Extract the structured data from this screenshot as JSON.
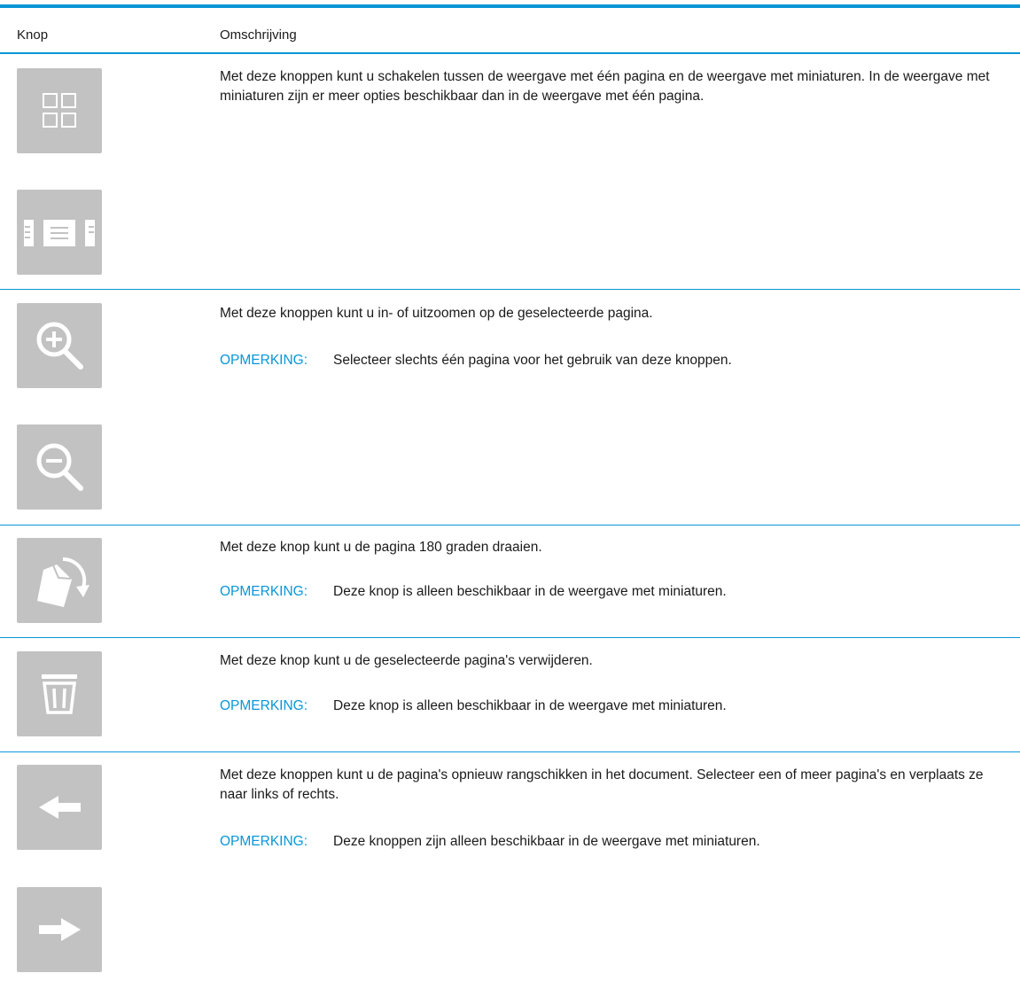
{
  "table": {
    "header": {
      "col_button": "Knop",
      "col_description": "Omschrijving"
    },
    "note_label": "OPMERKING:",
    "rows": [
      {
        "buttons": [
          "thumbnails-grid-icon",
          "single-page-view-icon"
        ],
        "description": "Met deze knoppen kunt u schakelen tussen de weergave met één pagina en de weergave met miniaturen. In de weergave met miniaturen zijn er meer opties beschikbaar dan in de weergave met één pagina.",
        "note": ""
      },
      {
        "buttons": [
          "zoom-in-icon",
          "zoom-out-icon"
        ],
        "description": "Met deze knoppen kunt u in- of uitzoomen op de geselecteerde pagina.",
        "note": "Selecteer slechts één pagina voor het gebruik van deze knoppen."
      },
      {
        "buttons": [
          "rotate-page-icon"
        ],
        "description": "Met deze knop kunt u de pagina 180 graden draaien.",
        "note": "Deze knop is alleen beschikbaar in de weergave met miniaturen."
      },
      {
        "buttons": [
          "trash-icon"
        ],
        "description": "Met deze knop kunt u de geselecteerde pagina's verwijderen.",
        "note": "Deze knop is alleen beschikbaar in de weergave met miniaturen."
      },
      {
        "buttons": [
          "arrow-left-icon",
          "arrow-right-icon"
        ],
        "description": "Met deze knoppen kunt u de pagina's opnieuw rangschikken in het document. Selecteer een of meer pagina's en verplaats ze naar links of rechts.",
        "note": "Deze knoppen zijn alleen beschikbaar in de weergave met miniaturen."
      }
    ]
  },
  "colors": {
    "accent": "#0a96d6",
    "button_bg": "#c2c2c2",
    "icon_fg": "#ffffff"
  }
}
